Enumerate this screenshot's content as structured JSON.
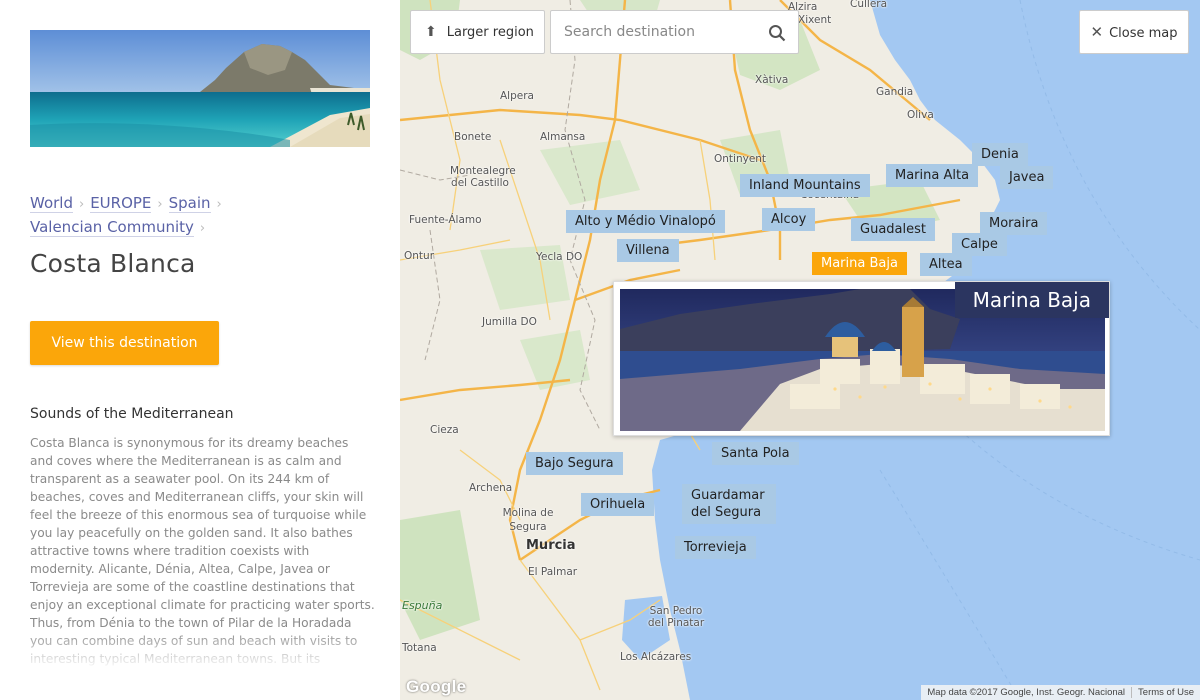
{
  "sidebar": {
    "breadcrumb": [
      "World",
      "EUROPE",
      "Spain",
      "Valencian Community"
    ],
    "title": "Costa Blanca",
    "view_button": "View this destination",
    "section_heading": "Sounds of the Mediterranean",
    "description": "Costa Blanca is synonymous for its dreamy beaches and coves where the Mediterranean is as calm and transparent as a seawater pool. On its 244 km of beaches, coves and Mediterranean cliffs, your skin will feel the breeze of this enormous sea of turquoise while you lay peacefully on the golden sand. It also bathes attractive towns where tradition coexists with modernity. Alicante, Dénia, Altea, Calpe, Javea or Torrevieja are some of the coastline destinations that enjoy an exceptional climate for practicing water sports. Thus, from Dénia to the town of Pilar de la Horadada you can combine days of sun and beach with visits to interesting typical Mediterranean towns. But its"
  },
  "map": {
    "larger_region": "Larger region",
    "search_placeholder": "Search destination",
    "close_map": "Close map",
    "popup_title": "Marina Baja",
    "google": "Google",
    "attribution": "Map data ©2017 Google, Inst. Geogr. Nacional",
    "terms": "Terms of Use",
    "towns": {
      "alzira": "Alzira",
      "xixent": "Xixent",
      "cullera": "Cullera",
      "alpera": "Alpera",
      "xativa": "Xàtiva",
      "gandia": "Gandia",
      "oliva": "Oliva",
      "bonete": "Bonete",
      "almansa": "Almansa",
      "ontinyent": "Ontinyent",
      "montealegre": "Montealegre del Castillo",
      "fuente_alamo": "Fuente-Álamo",
      "ontur": "Ontur",
      "yecla": "Yecla DO",
      "cocentaina": "Cocentaina",
      "jumilla": "Jumilla DO",
      "cieza": "Cieza",
      "archena": "Archena",
      "molina": "Molina de Segura",
      "murcia": "Murcia",
      "el_palmar": "El Palmar",
      "espuna": "Espuña",
      "totana": "Totana",
      "san_pedro": "San Pedro del Pinatar",
      "los_alcazares": "Los Alcázares"
    },
    "regions": {
      "denia": "Denia",
      "javea": "Javea",
      "marina_alta": "Marina Alta",
      "inland_mountains": "Inland Mountains",
      "moraira": "Moraira",
      "alto_medio": "Alto y Médio Vinalopó",
      "alcoy": "Alcoy",
      "guadalest": "Guadalest",
      "calpe": "Calpe",
      "villena": "Villena",
      "marina_baja": "Marina Baja",
      "altea": "Altea",
      "santa_pola": "Santa Pola",
      "bajo_segura": "Bajo Segura",
      "guardamar": "Guardamar del Segura",
      "orihuela": "Orihuela",
      "torrevieja": "Torrevieja"
    }
  },
  "colors": {
    "accent": "#fba60a",
    "region_tag": "#a9c9e5",
    "sea": "#a3c8f2",
    "land": "#f0ede4",
    "link": "#5a62a6",
    "popup_title_bg": "#2b3560"
  }
}
